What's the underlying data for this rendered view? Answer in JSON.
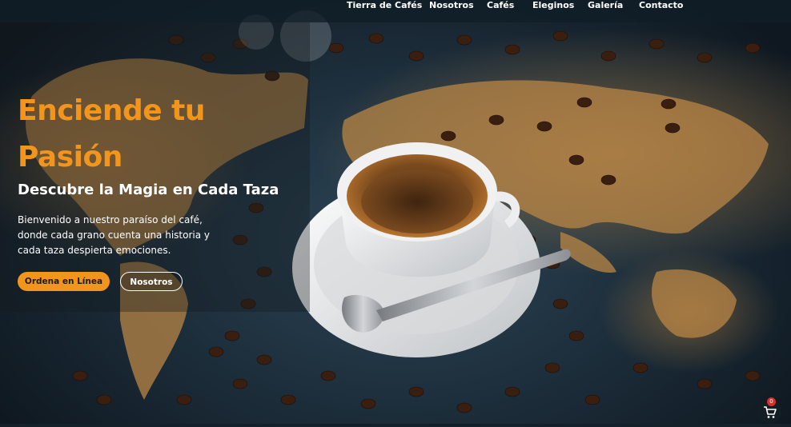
{
  "nav": {
    "items": [
      {
        "label": "Tierra de Cafés"
      },
      {
        "label": "Nosotros"
      },
      {
        "label": "Cafés"
      },
      {
        "label": "Eleginos"
      },
      {
        "label": "Galería"
      },
      {
        "label": "Contacto"
      }
    ]
  },
  "hero": {
    "title_line1": "Enciende tu",
    "title_line2": "Pasión",
    "subtitle": "Descubre la Magia en Cada Taza",
    "description": "Bienvenido a nuestro paraíso del café, donde cada grano cuenta una historia y cada taza despierta emociones.",
    "primary_button": "Ordena en Línea",
    "secondary_button": "Nosotros"
  },
  "cart": {
    "count": "0",
    "icon": "shopping-cart-icon"
  },
  "colors": {
    "accent": "#f2951c",
    "map_ocean": "#1c2d3a",
    "map_land": "#c48e48",
    "badge": "#d9302a"
  }
}
